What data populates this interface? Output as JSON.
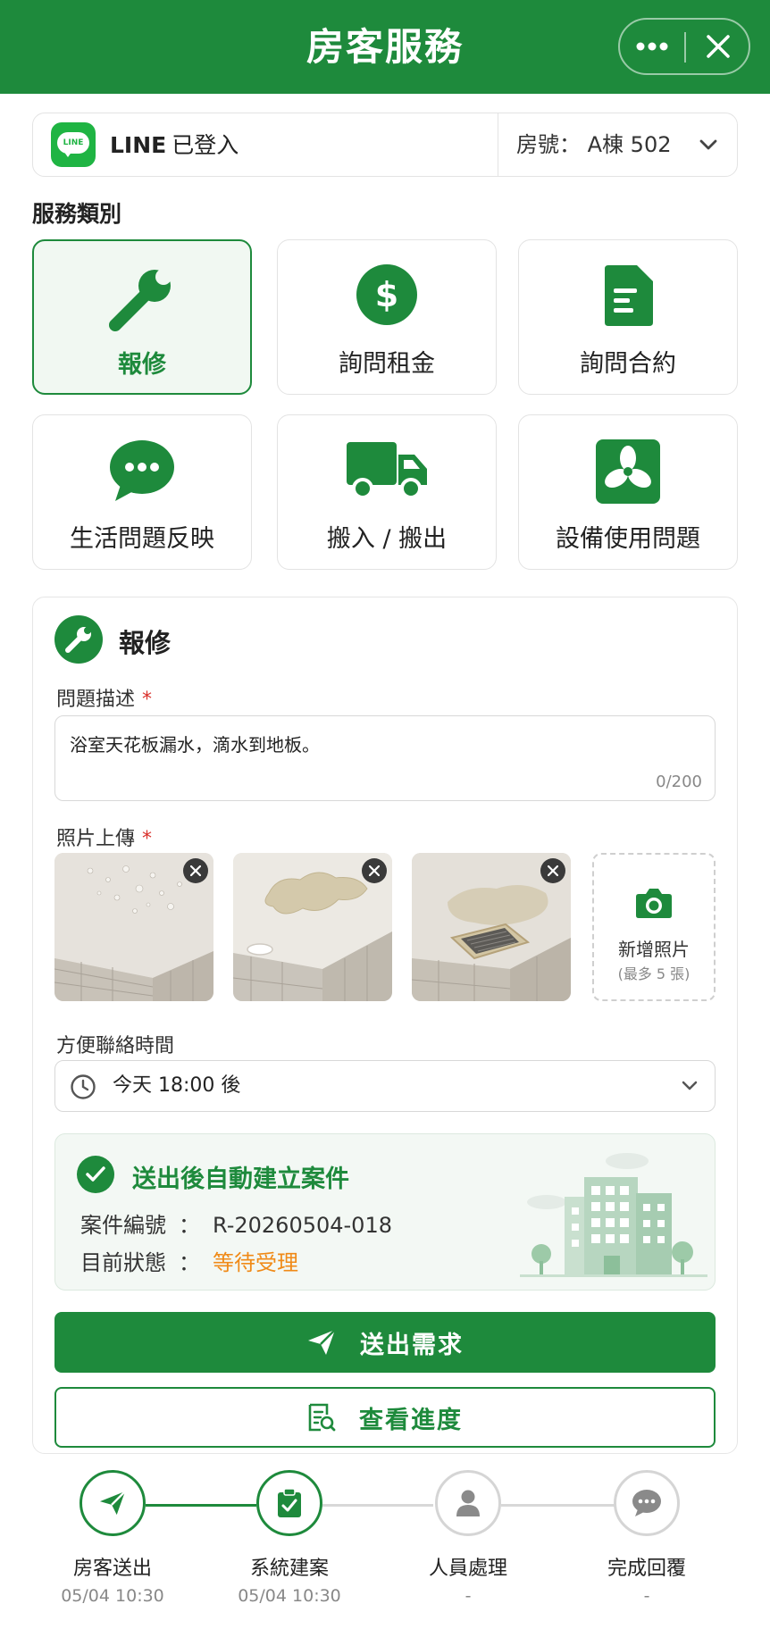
{
  "header": {
    "title": "房客服務"
  },
  "login": {
    "brand_badge": "LINE",
    "brand": "LINE",
    "status": "已登入"
  },
  "room": {
    "label": "房號：",
    "value": "A棟 502"
  },
  "section_label": "服務類別",
  "categories": [
    {
      "label": "報修",
      "icon": "wrench-icon",
      "selected": true
    },
    {
      "label": "詢問租金",
      "icon": "dollar-icon",
      "selected": false
    },
    {
      "label": "詢問合約",
      "icon": "document-icon",
      "selected": false
    },
    {
      "label": "生活問題反映",
      "icon": "chat-bubble-icon",
      "selected": false
    },
    {
      "label": "搬入 / 搬出",
      "icon": "truck-icon",
      "selected": false
    },
    {
      "label": "設備使用問題",
      "icon": "fan-icon",
      "selected": false
    }
  ],
  "form": {
    "title": "報修",
    "description_label": "問題描述",
    "required_mark": "*",
    "description_value": "浴室天花板漏水，滴水到地板。",
    "description_counter": "0/200",
    "photos_label": "照片上傳",
    "photos": [
      {
        "alt": "ceiling-water-drops-photo"
      },
      {
        "alt": "ceiling-stain-photo"
      },
      {
        "alt": "ceiling-vent-stain-photo"
      }
    ],
    "add_photo_label": "新增照片",
    "add_photo_hint": "(最多 5 張)",
    "contact_time_label": "方便聯絡時間",
    "contact_time_value": "今天 18:00 後"
  },
  "case": {
    "title": "送出後自動建立案件",
    "number_label": "案件編號",
    "colon": "：",
    "number_value": "R-20260504-018",
    "status_label": "目前狀態",
    "status_value": "等待受理"
  },
  "buttons": {
    "submit": "送出需求",
    "view_progress": "查看進度"
  },
  "steps": [
    {
      "label": "房客送出",
      "time": "05/04 10:30",
      "state": "done"
    },
    {
      "label": "系統建案",
      "time": "05/04 10:30",
      "state": "done"
    },
    {
      "label": "人員處理",
      "time": "-",
      "state": "pending"
    },
    {
      "label": "完成回覆",
      "time": "-",
      "state": "pending"
    }
  ],
  "colors": {
    "primary": "#1e8a3c",
    "line_green": "#1fb443",
    "status_orange": "#f08a17",
    "required_red": "#d9302b"
  }
}
